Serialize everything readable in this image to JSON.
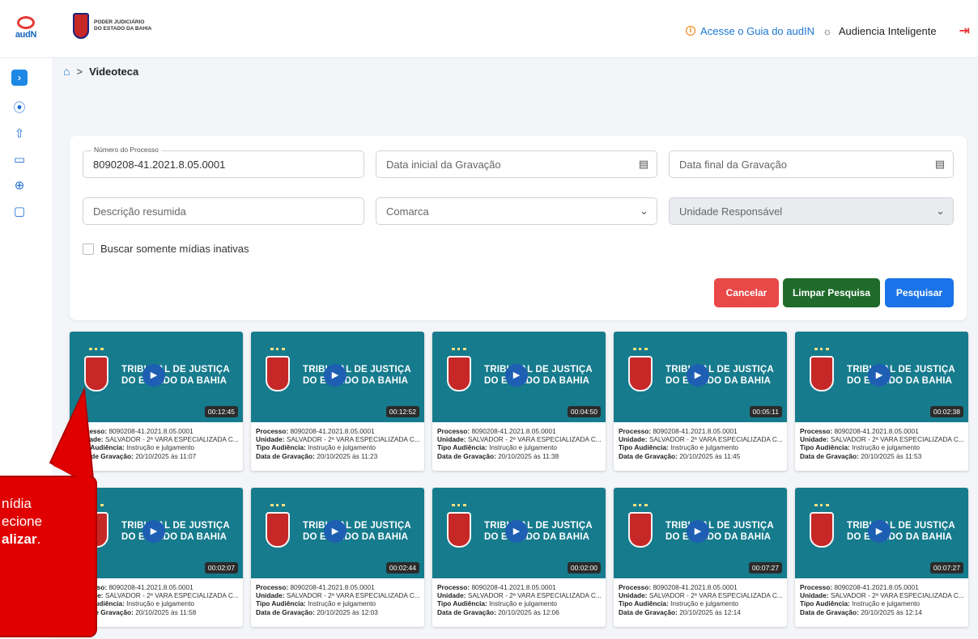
{
  "header": {
    "app_logo_text": "audN",
    "org_line1": "PODER JUDICIÁRIO",
    "org_line2": "DO ESTADO DA BAHIA",
    "guide_link": "Acesse o Guia do audIN",
    "ai_label": "Audiencia Inteligente",
    "icons": [
      "info-icon",
      "sun-icon",
      "logout-icon"
    ]
  },
  "sidebar": {
    "toggle": "›",
    "items": [
      "play-circle-icon",
      "upload-icon",
      "folder-icon",
      "add-circle-icon",
      "monitor-icon"
    ]
  },
  "breadcrumb": {
    "separator": ">",
    "current": "Videoteca"
  },
  "filters": {
    "process_label": "Número do Processo",
    "process_value": "8090208-41.2021.8.05.0001",
    "start_date_placeholder": "Data inicial da Gravação",
    "end_date_placeholder": "Data final da Gravação",
    "description_placeholder": "Descrição resumida",
    "comarca_placeholder": "Comarca",
    "unit_placeholder": "Unidade Responsável",
    "inactive_checkbox": "Buscar somente mídias inativas"
  },
  "buttons": {
    "cancel": "Cancelar",
    "clear": "Limpar Pesquisa",
    "search": "Pesquisar"
  },
  "thumbnail_text": {
    "line1": "TRIBUNAL DE JUSTIÇA",
    "line2": "DO ESTADO DA BAHIA"
  },
  "meta_labels": {
    "process": "Processo:",
    "unit": "Unidade:",
    "type": "Tipo Audiência:",
    "date": "Data de Gravação:"
  },
  "videos": [
    {
      "duration": "00:12:45",
      "process": "8090208-41.2021.8.05.0001",
      "unit": "SALVADOR - 2ª VARA ESPECIALIZADA C...",
      "type": "Instrução e julgamento",
      "date": "20/10/2025 às 11:07"
    },
    {
      "duration": "00:12:52",
      "process": "8090208-41.2021.8.05.0001",
      "unit": "SALVADOR - 2ª VARA ESPECIALIZADA C...",
      "type": "Instrução e julgamento",
      "date": "20/10/2025 às 11:23"
    },
    {
      "duration": "00:04:50",
      "process": "8090208-41.2021.8.05.0001",
      "unit": "SALVADOR - 2ª VARA ESPECIALIZADA C...",
      "type": "Instrução e julgamento",
      "date": "20/10/2025 às 11:38"
    },
    {
      "duration": "00:05:11",
      "process": "8090208-41.2021.8.05.0001",
      "unit": "SALVADOR - 2ª VARA ESPECIALIZADA C...",
      "type": "Instrução e julgamento",
      "date": "20/10/2025 às 11:45"
    },
    {
      "duration": "00:02:38",
      "process": "8090208-41.2021.8.05.0001",
      "unit": "SALVADOR - 2ª VARA ESPECIALIZADA C...",
      "type": "Instrução e julgamento",
      "date": "20/10/2025 às 11:53"
    },
    {
      "duration": "00:02:07",
      "process": "8090208-41.2021.8.05.0001",
      "unit": "SALVADOR - 2ª VARA ESPECIALIZADA C...",
      "type": "Instrução e julgamento",
      "date": "20/10/2025 às 11:58"
    },
    {
      "duration": "00:02:44",
      "process": "8090208-41.2021.8.05.0001",
      "unit": "SALVADOR - 2ª VARA ESPECIALIZADA C...",
      "type": "Instrução e julgamento",
      "date": "20/10/2025 às 12:03"
    },
    {
      "duration": "00:02:00",
      "process": "8090208-41.2021.8.05.0001",
      "unit": "SALVADOR - 2ª VARA ESPECIALIZADA C...",
      "type": "Instrução e julgamento",
      "date": "20/10/2025 às 12:06"
    },
    {
      "duration": "00:07:27",
      "process": "8090208-41.2021.8.05.0001",
      "unit": "SALVADOR - 2ª VARA ESPECIALIZADA C...",
      "type": "Instrução e julgamento",
      "date": "20/10/2025 às 12:14"
    },
    {
      "duration": "00:07:27",
      "process": "8090208-41.2021.8.05.0001",
      "unit": "SALVADOR - 2ª VARA ESPECIALIZADA C...",
      "type": "Instrução e julgamento",
      "date": "20/10/2025 às 12:14"
    }
  ],
  "callout": {
    "line1": "nídia",
    "line2": "ecione",
    "line3": "alizar",
    "line3_suffix": "."
  },
  "colors": {
    "accent": "#1e88e5",
    "cancel": "#e84848",
    "clear": "#1f6b2b",
    "search": "#1a73e8",
    "thumbnail": "#167b8d",
    "callout": "#e00000"
  }
}
